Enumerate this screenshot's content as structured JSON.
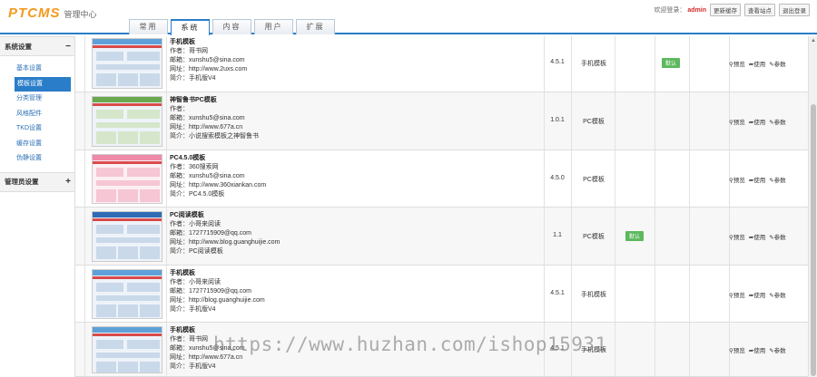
{
  "header": {
    "logo": "PTCMS",
    "logo_sub": "管理中心",
    "welcome": "欢迎登录：",
    "user": "admin",
    "buttons": [
      "更新缓存",
      "查看站点",
      "退出登录"
    ]
  },
  "tabs": [
    {
      "label": "常用",
      "active": false
    },
    {
      "label": "系统",
      "active": true
    },
    {
      "label": "内容",
      "active": false
    },
    {
      "label": "用户",
      "active": false
    },
    {
      "label": "扩展",
      "active": false
    }
  ],
  "sidebar": {
    "group1": {
      "title": "系统设置",
      "toggle": "−"
    },
    "items": [
      {
        "label": "基本设置",
        "active": false
      },
      {
        "label": "模板设置",
        "active": true
      },
      {
        "label": "分类管理",
        "active": false
      },
      {
        "label": "风格配件",
        "active": false
      },
      {
        "label": "TKD设置",
        "active": false
      },
      {
        "label": "缓存设置",
        "active": false
      },
      {
        "label": "伪静设置",
        "active": false
      }
    ],
    "group2": {
      "title": "管理员设置",
      "toggle": "+"
    }
  },
  "templates": [
    {
      "name": "手机模板",
      "author": "作者：哥书网",
      "email": "邮箱：xunshu5@sina.com",
      "site": "网址：http://www.2uxs.com",
      "intro": "简介：手机版V4",
      "version": "4.5.1",
      "type": "手机模板",
      "default": "默认",
      "default_col": "right"
    },
    {
      "name": "神智鲁书PC模板",
      "author": "作者：",
      "email": "邮箱：xunshu5@sina.com",
      "site": "网址：http://www.677a.cn",
      "intro": "简介：小说搜索模板之神智鲁书",
      "version": "1.0.1",
      "type": "PC模板",
      "default": "",
      "default_col": ""
    },
    {
      "name": "PC4.5.0模板",
      "author": "作者：360搜索网",
      "email": "邮箱：xunshu5@sina.com",
      "site": "网址：http://www.360xiankan.com",
      "intro": "简介：PC4.5.0模板",
      "version": "4.5.0",
      "type": "PC模板",
      "default": "",
      "default_col": ""
    },
    {
      "name": "PC阅读模板",
      "author": "作者：小哥来阅读",
      "email": "邮箱：1727715909@qq.com",
      "site": "网址：http://www.blog.guanghuijie.com",
      "intro": "简介：PC阅读模板",
      "version": "1.1",
      "type": "PC模板",
      "default": "默认",
      "default_col": "left"
    },
    {
      "name": "手机模板",
      "author": "作者：小哥来阅读",
      "email": "邮箱：1727715909@qq.com",
      "site": "网址：http://blog.guanghuijie.com",
      "intro": "简介：手机版V4",
      "version": "4.5.1",
      "type": "手机模板",
      "default": "",
      "default_col": ""
    },
    {
      "name": "手机模板",
      "author": "作者：哥书网",
      "email": "邮箱：xunshu5@sina.com",
      "site": "网址：http://www.677a.cn",
      "intro": "简介：手机版V4",
      "version": "4.5.1",
      "type": "手机模板",
      "default": "",
      "default_col": ""
    }
  ],
  "ops": [
    "预览",
    "使用",
    "参数"
  ],
  "watermark": "https://www.huzhan.com/ishop15931"
}
